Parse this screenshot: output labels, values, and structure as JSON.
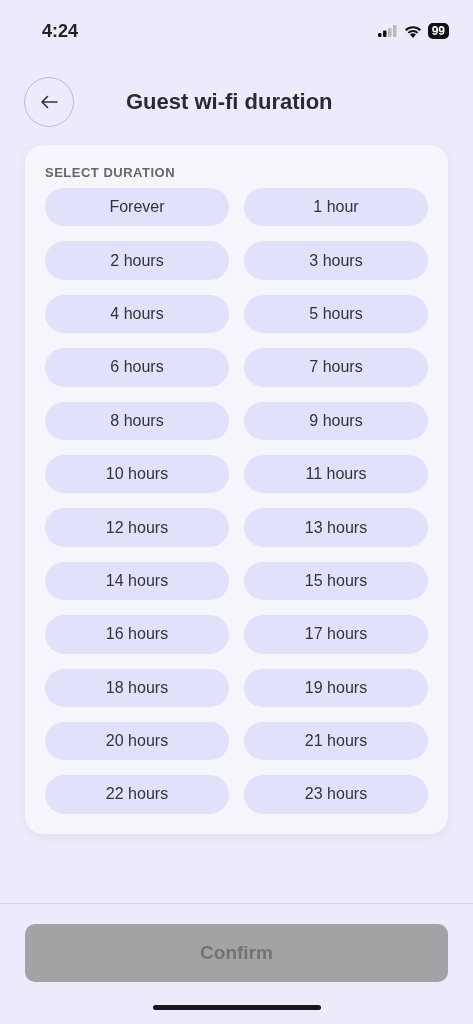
{
  "status_bar": {
    "time": "4:24",
    "battery": "99"
  },
  "header": {
    "title": "Guest wi-fi duration"
  },
  "section_label": "SELECT DURATION",
  "options": [
    {
      "label": "Forever",
      "selected": false
    },
    {
      "label": "1 hour",
      "selected": false
    },
    {
      "label": "2 hours",
      "selected": false
    },
    {
      "label": "3 hours",
      "selected": false
    },
    {
      "label": "4 hours",
      "selected": false
    },
    {
      "label": "5 hours",
      "selected": false
    },
    {
      "label": "6 hours",
      "selected": false
    },
    {
      "label": "7 hours",
      "selected": false
    },
    {
      "label": "8 hours",
      "selected": false
    },
    {
      "label": "9 hours",
      "selected": false
    },
    {
      "label": "10 hours",
      "selected": false
    },
    {
      "label": "11 hours",
      "selected": false
    },
    {
      "label": "12 hours",
      "selected": false
    },
    {
      "label": "13 hours",
      "selected": false
    },
    {
      "label": "14 hours",
      "selected": false
    },
    {
      "label": "15 hours",
      "selected": false
    },
    {
      "label": "16 hours",
      "selected": false
    },
    {
      "label": "17 hours",
      "selected": false
    },
    {
      "label": "18 hours",
      "selected": false
    },
    {
      "label": "19 hours",
      "selected": false
    },
    {
      "label": "20 hours",
      "selected": false
    },
    {
      "label": "21 hours",
      "selected": false
    },
    {
      "label": "22 hours",
      "selected": false
    },
    {
      "label": "23 hours",
      "selected": false
    }
  ],
  "confirm": {
    "label": "Confirm",
    "disabled": true
  }
}
